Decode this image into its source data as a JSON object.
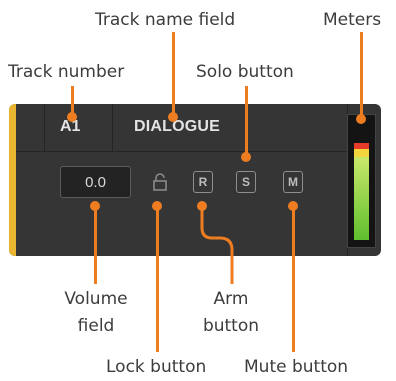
{
  "callouts": {
    "track_name_field": "Track name field",
    "meters": "Meters",
    "track_number": "Track number",
    "solo_button": "Solo button",
    "volume_field_line1": "Volume",
    "volume_field_line2": "field",
    "arm_button_line1": "Arm",
    "arm_button_line2": "button",
    "lock_button": "Lock button",
    "mute_button": "Mute button"
  },
  "track": {
    "number": "A1",
    "name": "DIALOGUE",
    "volume": "0.0",
    "buttons": {
      "arm": "R",
      "solo": "S",
      "mute": "M"
    }
  },
  "meter": {
    "colors": [
      "#e63a2a",
      "#f2d53c",
      "#c9e86a",
      "#5fbf2e"
    ]
  },
  "colors": {
    "accent": "#ee7d22",
    "track_stripe": "#e8b631",
    "panel": "#353535"
  }
}
